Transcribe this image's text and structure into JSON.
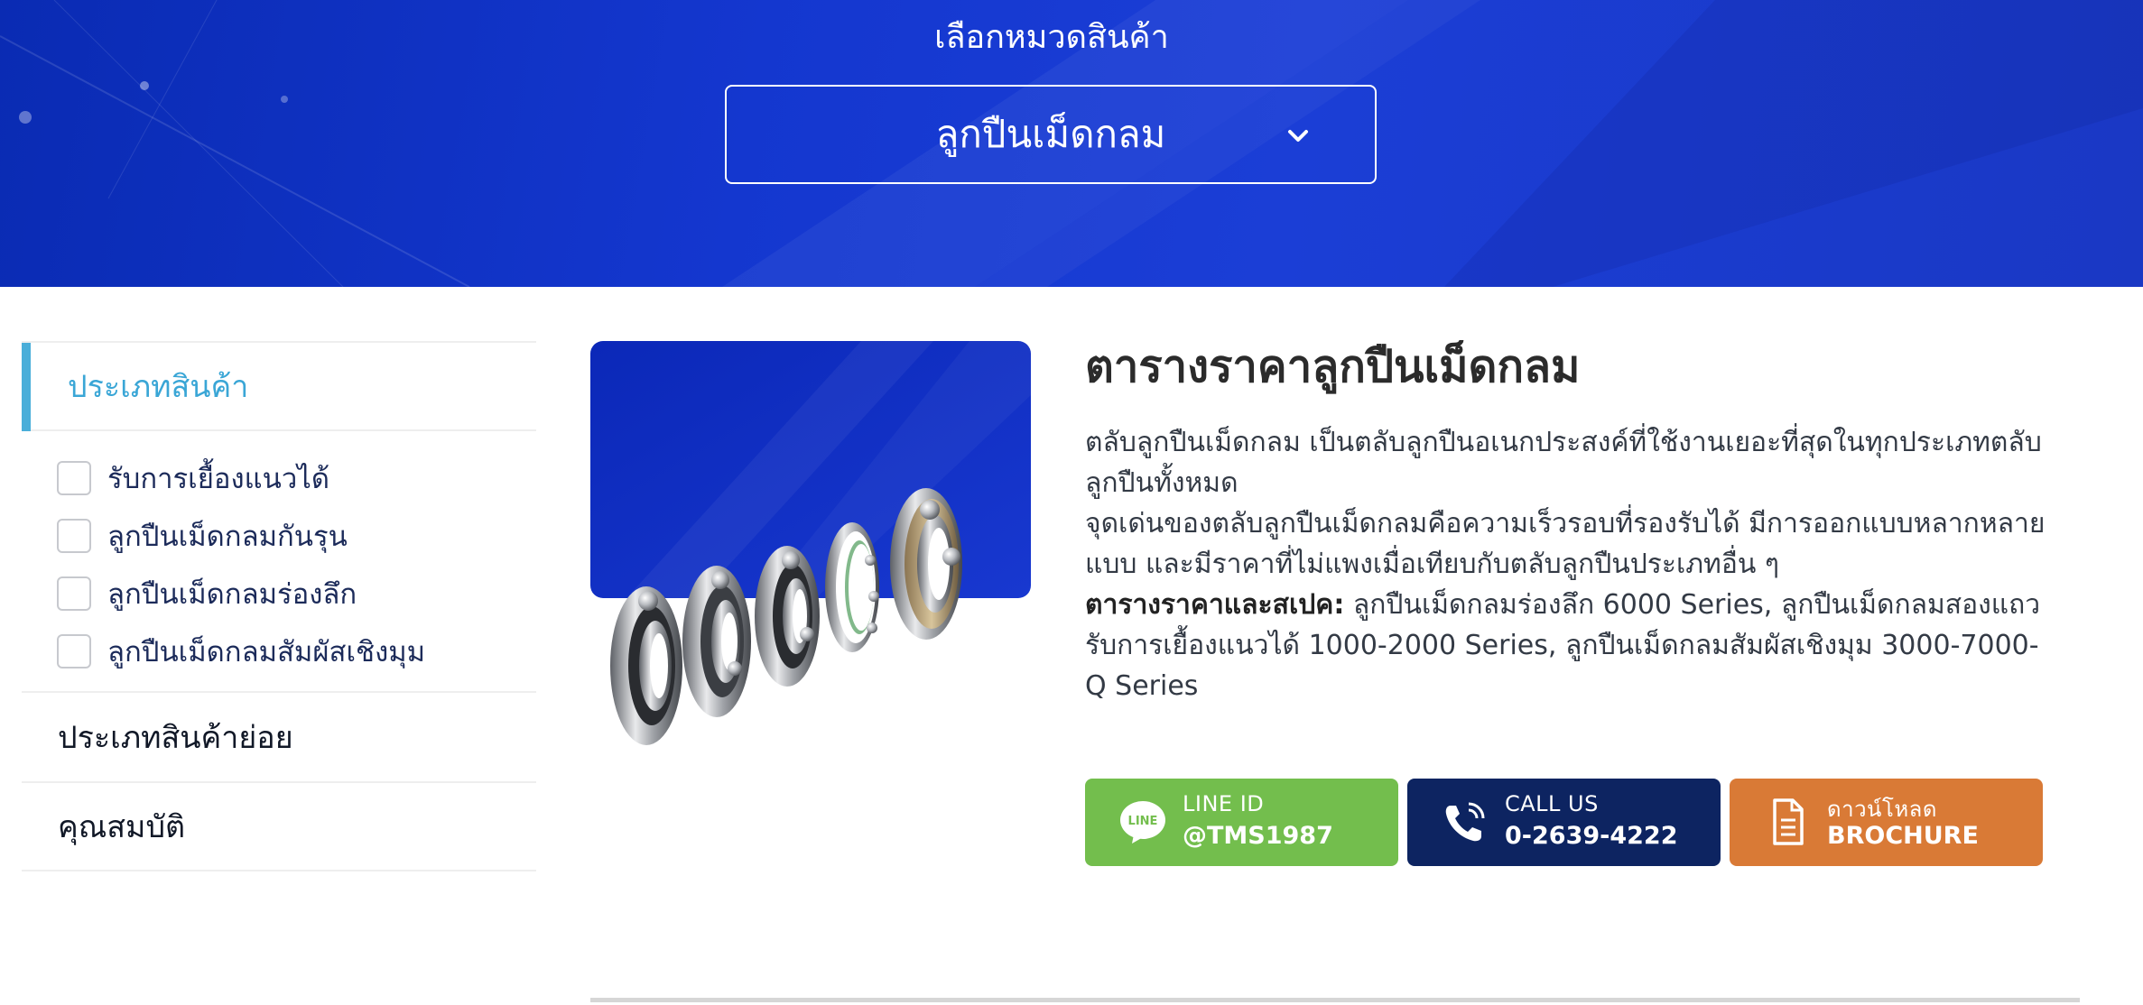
{
  "hero": {
    "title": "เลือกหมวดสินค้า",
    "selected_category": "ลูกปืนเม็ดกลม",
    "icon": "chevron-down-icon"
  },
  "sidebar": {
    "header": "ประเภทสินค้า",
    "items": [
      {
        "label": "รับการเยื้องแนวได้",
        "checked": false
      },
      {
        "label": "ลูกปืนเม็ดกลมกันรุน",
        "checked": false
      },
      {
        "label": "ลูกปืนเม็ดกลมร่องลึก",
        "checked": false
      },
      {
        "label": "ลูกปืนเม็ดกลมสัมผัสเชิงมุม",
        "checked": false
      }
    ],
    "sections": [
      "ประเภทสินค้าย่อย",
      "คุณสมบัติ"
    ]
  },
  "product": {
    "title": "ตารางราคาลูกปืนเม็ดกลม",
    "description_1": "ตลับลูกปืนเม็ดกลม เป็นตลับลูกปืนอเนกประสงค์ที่ใช้งานเยอะที่สุดในทุกประเภทตลับลูกปืนทั้งหมด",
    "description_2": "จุดเด่นของตลับลูกปืนเม็ดกลมคือความเร็วรอบที่รองรับได้ มีการออกแบบหลากหลายแบบ และมีราคาที่ไม่แพงเมื่อเทียบกับตลับลูกปืนประเภทอื่น ๆ",
    "spec_label": "ตารางราคาและสเปค:",
    "spec_text": " ลูกปืนเม็ดกลมร่องลึก 6000 Series, ลูกปืนเม็ดกลมสองแถวรับการเยื้องแนวได้ 1000-2000 Series, ลูกปืนเม็ดกลมสัมผัสเชิงมุม 3000-7000-Q Series",
    "image_icon": "ball-bearings-image"
  },
  "cta": {
    "line": {
      "label": "LINE ID",
      "value": "@TMS1987",
      "icon": "line-icon",
      "color": "#73be4d"
    },
    "call": {
      "label": "CALL US",
      "value": "0-2639-4222",
      "icon": "phone-icon",
      "color": "#0d2461"
    },
    "brochure": {
      "label": "ดาวน์โหลด",
      "value": "BROCHURE",
      "icon": "document-icon",
      "color": "#d97a36"
    }
  },
  "colors": {
    "hero_blue": "#1437cf",
    "accent_cyan": "#3aa6d6"
  }
}
